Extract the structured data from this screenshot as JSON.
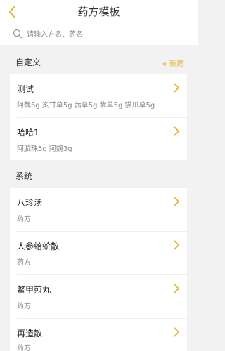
{
  "header": {
    "title": "药方模板"
  },
  "search": {
    "placeholder": "请输入方名、药名"
  },
  "custom": {
    "section_title": "自定义",
    "new_label": "+ 新建",
    "items": [
      {
        "title": "测试",
        "subtitle": "阿魏6g 炙甘草5g 茜草5g 紫草5g 猫爪草5g"
      },
      {
        "title": "哈哈1",
        "subtitle": "阿胶珠5g 阿魏3g"
      }
    ]
  },
  "system": {
    "section_title": "系统",
    "items": [
      {
        "title": "八珍汤",
        "subtitle": "药方"
      },
      {
        "title": "人参蛤蚧散",
        "subtitle": "药方"
      },
      {
        "title": "鳖甲煎丸",
        "subtitle": "药方"
      },
      {
        "title": "再造散",
        "subtitle": "药方"
      }
    ]
  },
  "colors": {
    "accent": "#e4b53e",
    "background": "#f2f2f2",
    "card": "#ffffff"
  }
}
